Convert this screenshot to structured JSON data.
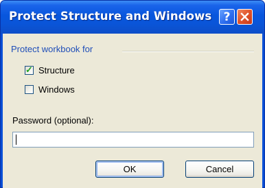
{
  "window": {
    "title": "Protect Structure and Windows",
    "help_label": "?",
    "colors": {
      "titlebar": "#0a55d8",
      "client": "#ece9d8",
      "close_button": "#e0532a",
      "group_label": "#1f4eb8"
    }
  },
  "group": {
    "label": "Protect workbook for"
  },
  "options": {
    "structure": {
      "label": "Structure",
      "checked": true
    },
    "windows": {
      "label": "Windows",
      "checked": false
    }
  },
  "password": {
    "label": "Password (optional):",
    "value": ""
  },
  "buttons": {
    "ok_label": "OK",
    "cancel_label": "Cancel"
  },
  "icons": {
    "help": "help-icon",
    "close": "close-icon",
    "check": "checkmark-icon"
  }
}
